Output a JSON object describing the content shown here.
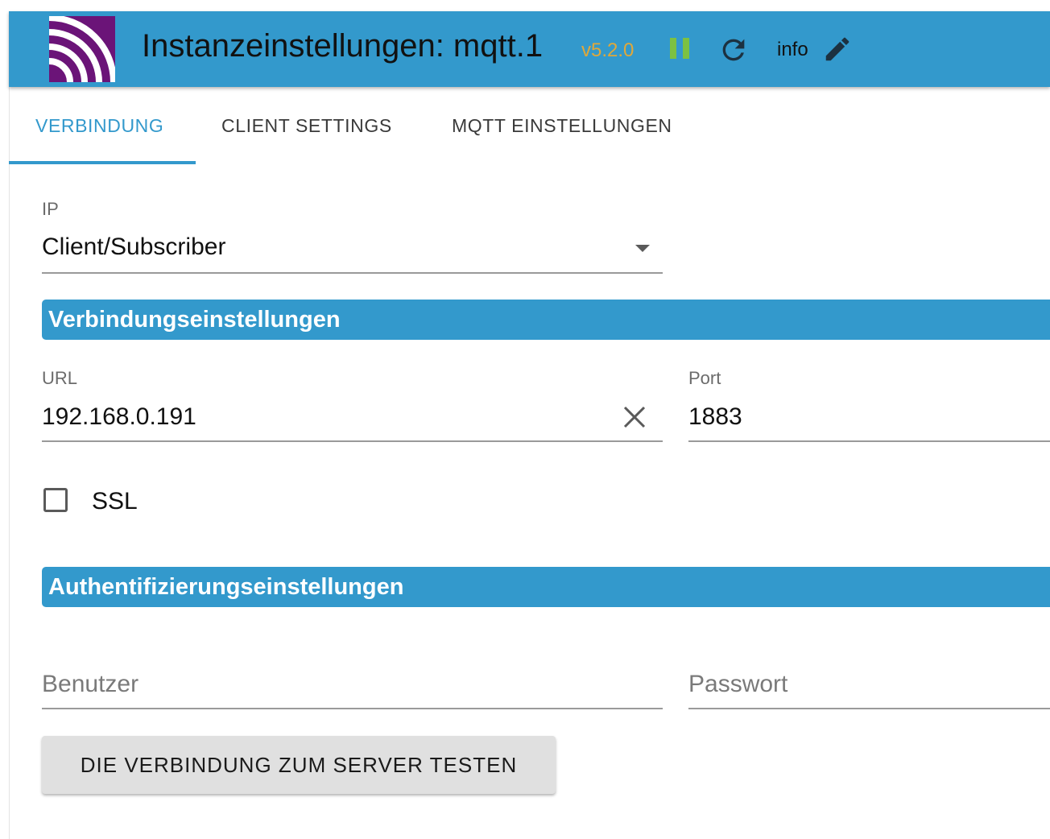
{
  "header": {
    "title": "Instanzeinstellungen: mqtt.1",
    "version": "v5.2.0",
    "info_label": "info",
    "logo_icon": "mqtt-logo-icon",
    "pause_icon": "pause-icon",
    "refresh_icon": "refresh-icon",
    "edit_icon": "pencil-icon",
    "colors": {
      "header_bg": "#3399cc",
      "version": "#e0a83a",
      "pause": "#7cc142",
      "logo_bg": "#6b1478"
    }
  },
  "tabs": [
    {
      "label": "VERBINDUNG",
      "active": true
    },
    {
      "label": "CLIENT SETTINGS",
      "active": false
    },
    {
      "label": "MQTT EINSTELLUNGEN",
      "active": false
    }
  ],
  "form": {
    "ip": {
      "label": "IP",
      "value": "Client/Subscriber"
    },
    "connection_section": {
      "title": "Verbindungseinstellungen"
    },
    "url": {
      "label": "URL",
      "value": "192.168.0.191"
    },
    "port": {
      "label": "Port",
      "value": "1883"
    },
    "ssl": {
      "label": "SSL",
      "checked": false
    },
    "auth_section": {
      "title": "Authentifizierungseinstellungen"
    },
    "user": {
      "placeholder": "Benutzer"
    },
    "password": {
      "placeholder": "Passwort"
    },
    "test_button": {
      "label": "DIE VERBINDUNG ZUM SERVER TESTEN"
    }
  },
  "accent_color": "#3399cc"
}
